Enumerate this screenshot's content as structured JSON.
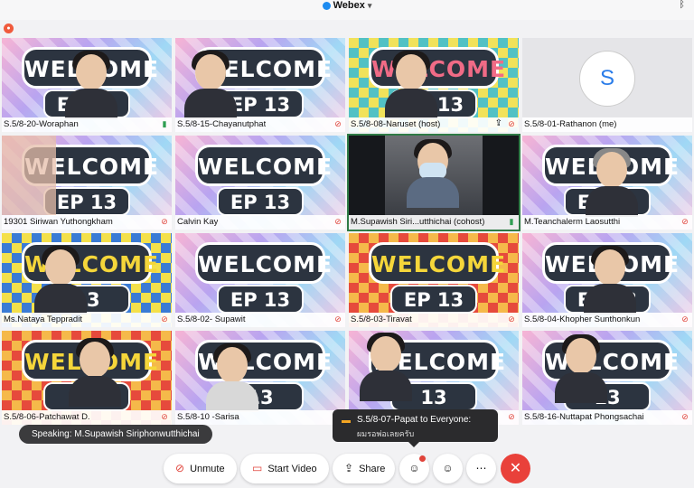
{
  "app": {
    "title": "Webex"
  },
  "tiles": [
    {
      "name": "S.5/8-20-Woraphan",
      "mic": "live",
      "mic_icon": "mic-on-icon",
      "sign": "WELCOME",
      "ep": "EP 13"
    },
    {
      "name": "S.5/8-15-Chayanutphat",
      "mic": "muted",
      "mic_icon": "mic-off-icon",
      "sign": "WELCOME",
      "ep": "EP 13"
    },
    {
      "name": "S.5/8-08-Naruset (host)",
      "mic": "muted",
      "mic_icon": "mic-off-icon",
      "sign": "WELCOME",
      "ep": "EP 13",
      "share_icon": "share-screen-icon"
    },
    {
      "name": "S.5/8-01-Rathanon (me)",
      "mic": "none",
      "avatar_initial": "S"
    },
    {
      "name": "19301 Siriwan Yuthongkham",
      "mic": "muted",
      "mic_icon": "mic-off-icon",
      "sign": "WELCOME",
      "ep": "EP 13"
    },
    {
      "name": "Calvin Kay",
      "mic": "muted",
      "mic_icon": "mic-off-icon",
      "sign": "WELCOME",
      "ep": "EP 13"
    },
    {
      "name": "M.Supawish Siri...utthichai (cohost)",
      "mic": "live",
      "mic_icon": "mic-on-icon"
    },
    {
      "name": "M.Teanchalerm Laosutthi",
      "mic": "muted",
      "mic_icon": "mic-off-icon",
      "sign": "WELCOME",
      "ep": "EP 13"
    },
    {
      "name": "Ms.Nataya Teppradit",
      "mic": "muted",
      "mic_icon": "mic-off-icon",
      "sign": "WELCOME",
      "ep": "13"
    },
    {
      "name": "S.5/8-02- Supawit",
      "mic": "muted",
      "mic_icon": "mic-off-icon",
      "sign": "WELCOME",
      "ep": "EP 13"
    },
    {
      "name": "S.5/8-03-Tiravat",
      "mic": "muted",
      "mic_icon": "mic-off-icon",
      "sign": "WELCOME",
      "ep": "EP 13"
    },
    {
      "name": "S.5/8-04-Khopher Sunthonkun",
      "mic": "muted",
      "mic_icon": "mic-off-icon",
      "sign": "WELCOME",
      "ep": "EP 13"
    },
    {
      "name": "S.5/8-06-Patchawat D.",
      "mic": "muted",
      "mic_icon": "mic-off-icon",
      "sign": "WELCOME",
      "ep": "EP"
    },
    {
      "name": "S.5/8-10 -Sarisa",
      "mic": "muted",
      "mic_icon": "mic-off-icon",
      "sign": "WELCOME",
      "ep": "13"
    },
    {
      "name": "",
      "mic": "muted",
      "mic_icon": "mic-off-icon",
      "sign": "WELCOME",
      "ep": "13"
    },
    {
      "name": "S.5/8-16-Nuttapat Phongsachai",
      "mic": "muted",
      "mic_icon": "mic-off-icon",
      "sign": "WELCOME",
      "ep": "13"
    }
  ],
  "speaking_banner": "Speaking: M.Supawish Siriphonwutthichai",
  "chat_popup": {
    "from": "S.5/8-07-Papat to Everyone:",
    "message": "ผมรอพ่อเลยครับ"
  },
  "toolbar": {
    "unmute_label": "Unmute",
    "start_video_label": "Start Video",
    "share_label": "Share"
  },
  "colors": {
    "accent": "#1d8bf0",
    "leave": "#e9413a",
    "mute_red": "#e0433a",
    "active_green": "#2f7b46"
  }
}
